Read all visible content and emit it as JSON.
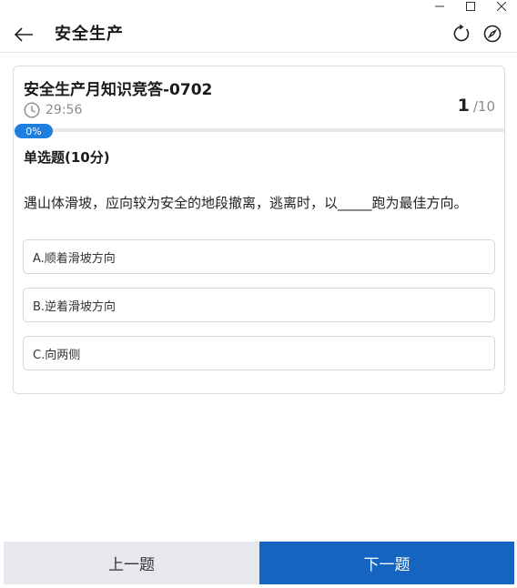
{
  "header": {
    "title": "安全生产",
    "icons": [
      "back-arrow-icon",
      "refresh-icon",
      "compass-icon"
    ]
  },
  "window": {
    "icons": [
      "minimize-icon",
      "maximize-icon",
      "close-icon"
    ]
  },
  "quiz": {
    "title": "安全生产月知识竞答-0702",
    "timer": "29:56",
    "current": "1",
    "total": "/10",
    "progress_label": "0%",
    "progress_fraction": 0.0
  },
  "question": {
    "type": "单选题(10分)",
    "text": "遇山体滑坡，应向较为安全的地段撤离，逃离时，以_____跑为最佳方向。",
    "options": [
      {
        "label": "A.顺着滑坡方向"
      },
      {
        "label": "B.逆着滑坡方向"
      },
      {
        "label": "C.向两侧"
      }
    ]
  },
  "footer": {
    "prev_label": "上一题",
    "next_label": "下一题"
  },
  "colors": {
    "accent": "#1e7fe0",
    "next_button": "#1565c0",
    "prev_button": "#e6e8ee"
  }
}
